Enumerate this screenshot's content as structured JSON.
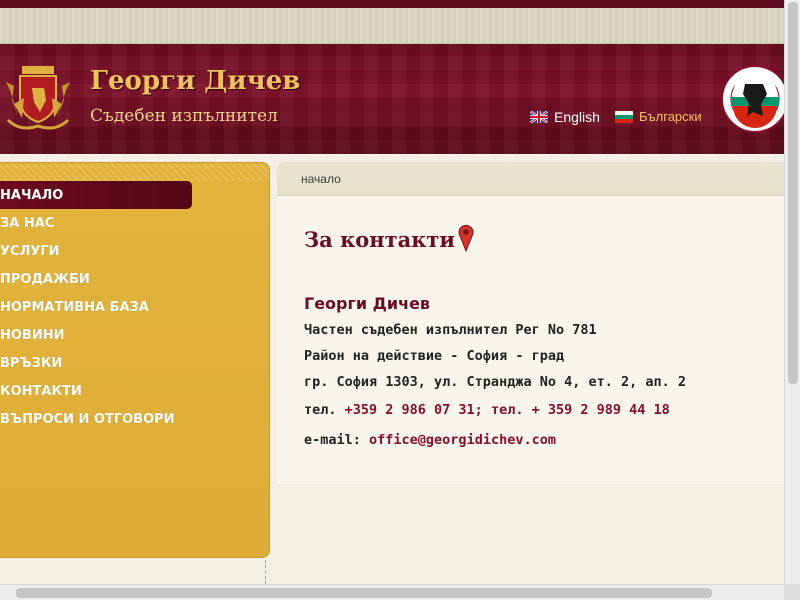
{
  "header": {
    "title": "Георги Дичев",
    "subtitle": "Съдебен изпълнител",
    "languages": [
      {
        "label": "English",
        "flag": "uk-flag-icon"
      },
      {
        "label": "Български",
        "flag": "bulgaria-flag-icon"
      }
    ],
    "crest_icon": "bulgarian-coat-of-arms-icon",
    "seal_icon": "chamber-of-bailiffs-seal-icon"
  },
  "nav": {
    "items": [
      {
        "label": "НАЧАЛО",
        "active": true
      },
      {
        "label": "ЗА НАС",
        "active": false
      },
      {
        "label": "УСЛУГИ",
        "active": false
      },
      {
        "label": "ПРОДАЖБИ",
        "active": false
      },
      {
        "label": "НОРМАТИВНА БАЗА",
        "active": false
      },
      {
        "label": "НОВИНИ",
        "active": false
      },
      {
        "label": "ВРЪЗКИ",
        "active": false
      },
      {
        "label": "КОНТАКТИ",
        "active": false
      },
      {
        "label": "ВЪПРОСИ И ОТГОВОРИ",
        "active": false
      }
    ]
  },
  "breadcrumb": "начало",
  "contact": {
    "heading": "За контакти",
    "name": "Георги Дичев",
    "line1": "Частен съдебен изпълнител Рег No 781",
    "line2": "Район на действие - София - град",
    "line3": "гр. София 1303, ул. Странджа No 4, ет. 2, ап. 2",
    "phone_prefix": "тел. ",
    "phones": "+359 2 986 07 31; тел. + 359 2 989 44 18",
    "email_prefix": "e-mail: ",
    "email": "office@georgidichev.com"
  },
  "colors": {
    "brand_maroon": "#6b0c22",
    "gold": "#f0c35a",
    "sidebar_gold": "#e2b43c"
  }
}
